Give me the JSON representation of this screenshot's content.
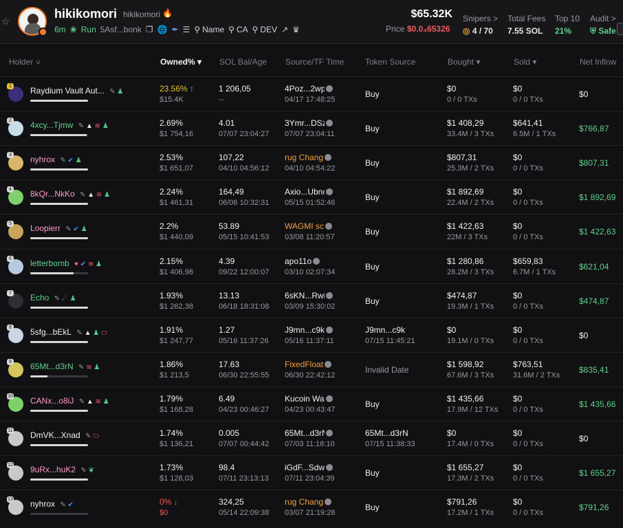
{
  "header": {
    "token_name": "hikikomori",
    "token_symbol": "hikikomori",
    "age": "6m",
    "run_label": "Run",
    "contract_short": "5Asf...bonk",
    "search_links": [
      "Name",
      "CA",
      "DEV"
    ],
    "market_cap": "$65.32K",
    "price_label": "Price",
    "price_value": "$0.0₄65326",
    "stats": [
      {
        "label": "Snipers >",
        "value": "4 / 70"
      },
      {
        "label": "Total Fees",
        "value": "7.55 SOL"
      },
      {
        "label": "Top 10",
        "value": "21%"
      },
      {
        "label": "Audit >",
        "value": "Safe"
      }
    ]
  },
  "columns": {
    "holder": "Holder",
    "owned": "Owned%",
    "sol_bal": "SOL Bal/Age",
    "source": "Source/TF Time",
    "token_source": "Token Source",
    "bought": "Bought",
    "sold": "Sold",
    "net_inflow": "Net Inflow"
  },
  "holders": [
    {
      "rank": "1",
      "name": "Raydium Vault Aut...",
      "owned": "23.56%",
      "owned_usd": "$15.4K",
      "sol": "1 206,05",
      "age": "--",
      "source": "4Poz...2wp",
      "source_time": "04/17 17:48:25",
      "token_source": "Buy",
      "token_source_time": "",
      "bought": "$0",
      "bought_txs": "0 / 0 TXs",
      "sold": "$0",
      "sold_txs": "0 / 0 TXs",
      "net": "$0",
      "bar_fill": 1.0
    },
    {
      "rank": "2",
      "name": "4xcy...Tjmw",
      "owned": "2.69%",
      "owned_usd": "$1 754,16",
      "sol": "4.01",
      "age": "07/07 23:04:27",
      "source": "3Ymr...DSz",
      "source_time": "07/07 23:04:11",
      "token_source": "Buy",
      "token_source_time": "",
      "bought": "$1 408,29",
      "bought_txs": "33.4M / 3 TXs",
      "sold": "$641,41",
      "sold_txs": "6.5M / 1 TXs",
      "net": "$766,87",
      "bar_fill": 0.98
    },
    {
      "rank": "3",
      "name": "nyhrox",
      "owned": "2.53%",
      "owned_usd": "$1 651,07",
      "sol": "107,22",
      "age": "04/10 04:56:12",
      "source": "rug Chang",
      "source_time": "04/10 04:54:22",
      "token_source": "Buy",
      "token_source_time": "",
      "bought": "$807,31",
      "bought_txs": "25.3M / 2 TXs",
      "sold": "$0",
      "sold_txs": "0 / 0 TXs",
      "net": "$807,31",
      "bar_fill": 1.0
    },
    {
      "rank": "4",
      "name": "8kQr...NkKo",
      "owned": "2.24%",
      "owned_usd": "$1 461,31",
      "sol": "164,49",
      "age": "06/06 10:32:31",
      "source": "Axio...Ubnc",
      "source_time": "05/15 01:52:46",
      "token_source": "Buy",
      "token_source_time": "",
      "bought": "$1 892,69",
      "bought_txs": "22.4M / 2 TXs",
      "sold": "$0",
      "sold_txs": "0 / 0 TXs",
      "net": "$1 892,69",
      "bar_fill": 1.0
    },
    {
      "rank": "5",
      "name": "Loopierr",
      "owned": "2.2%",
      "owned_usd": "$1 440,09",
      "sol": "53.89",
      "age": "05/15 10:41:53",
      "source": "WAGMI sc",
      "source_time": "03/08 11:20:57",
      "token_source": "Buy",
      "token_source_time": "",
      "bought": "$1 422,63",
      "bought_txs": "22M / 3 TXs",
      "sold": "$0",
      "sold_txs": "0 / 0 TXs",
      "net": "$1 422,63",
      "bar_fill": 1.0
    },
    {
      "rank": "6",
      "name": "letterbomb",
      "owned": "2.15%",
      "owned_usd": "$1 406,98",
      "sol": "4.39",
      "age": "09/22 12:00:07",
      "source": "apo11o",
      "source_time": "03/10 02:07:34",
      "token_source": "Buy",
      "token_source_time": "",
      "bought": "$1 280,86",
      "bought_txs": "28.2M / 3 TXs",
      "sold": "$659,83",
      "sold_txs": "6.7M / 1 TXs",
      "net": "$621,04",
      "bar_fill": 0.75
    },
    {
      "rank": "7",
      "name": "Echo",
      "owned": "1.93%",
      "owned_usd": "$1 262,38",
      "sol": "13.13",
      "age": "06/18 18:31:08",
      "source": "6sKN...Rwi",
      "source_time": "03/09 15:30:02",
      "token_source": "Buy",
      "token_source_time": "",
      "bought": "$474,87",
      "bought_txs": "19.3M / 1 TXs",
      "sold": "$0",
      "sold_txs": "0 / 0 TXs",
      "net": "$474,87",
      "bar_fill": 1.0
    },
    {
      "rank": "8",
      "name": "5sfg...bEkL",
      "owned": "1.91%",
      "owned_usd": "$1 247,77",
      "sol": "1.27",
      "age": "05/16 11:37:26",
      "source": "J9mn...c9k",
      "source_time": "05/16 11:37:11",
      "token_source": "J9mn...c9k",
      "token_source_time": "07/15 11:45:21",
      "bought": "$0",
      "bought_txs": "19.1M / 0 TXs",
      "sold": "$0",
      "sold_txs": "0 / 0 TXs",
      "net": "$0",
      "bar_fill": 1.0
    },
    {
      "rank": "9",
      "name": "65Mt...d3rN",
      "owned": "1.86%",
      "owned_usd": "$1 213,5",
      "sol": "17.63",
      "age": "06/30 22:55:55",
      "source": "FixedFloat",
      "source_time": "06/30 22:42:12",
      "token_source": "Invalid Date",
      "token_source_time": "",
      "bought": "$1 598,92",
      "bought_txs": "67.6M / 3 TXs",
      "sold": "$763,51",
      "sold_txs": "31.6M / 2 TXs",
      "net": "$835,41",
      "bar_fill": 0.3
    },
    {
      "rank": "10",
      "name": "CANx...o8iJ",
      "owned": "1.79%",
      "owned_usd": "$1 168,28",
      "sol": "6.49",
      "age": "04/23 00:46:27",
      "source": "Kucoin Wa",
      "source_time": "04/23 00:43:47",
      "token_source": "Buy",
      "token_source_time": "",
      "bought": "$1 435,66",
      "bought_txs": "17.9M / 12 TXs",
      "sold": "$0",
      "sold_txs": "0 / 0 TXs",
      "net": "$1 435,66",
      "bar_fill": 1.0
    },
    {
      "rank": "11",
      "name": "DmVK...Xnad",
      "owned": "1.74%",
      "owned_usd": "$1 136,21",
      "sol": "0.005",
      "age": "07/07 00:44:42",
      "source": "65Mt...d3rN",
      "source_time": "07/03 11:18:10",
      "token_source": "65Mt...d3rN",
      "token_source_time": "07/15 11:38:33",
      "bought": "$0",
      "bought_txs": "17.4M / 0 TXs",
      "sold": "$0",
      "sold_txs": "0 / 0 TXs",
      "net": "$0",
      "bar_fill": 1.0
    },
    {
      "rank": "12",
      "name": "9uRx...huK2",
      "owned": "1.73%",
      "owned_usd": "$1 128,03",
      "sol": "98.4",
      "age": "07/11 23:13:13",
      "source": "iGdF...Sdw",
      "source_time": "07/11 23:04:39",
      "token_source": "Buy",
      "token_source_time": "",
      "bought": "$1 655,27",
      "bought_txs": "17.3M / 2 TXs",
      "sold": "$0",
      "sold_txs": "0 / 0 TXs",
      "net": "$1 655,27",
      "bar_fill": 1.0
    },
    {
      "rank": "13",
      "name": "nyhrox",
      "owned": "0%",
      "owned_usd": "$0",
      "sol": "324,25",
      "age": "05/14 22:09:38",
      "source": "rug Chang",
      "source_time": "03/07 21:19:28",
      "token_source": "Buy",
      "token_source_time": "",
      "bought": "$791,26",
      "bought_txs": "17.2M / 1 TXs",
      "sold": "$0",
      "sold_txs": "0 / 0 TXs",
      "net": "$791,26",
      "bar_fill": 0.0
    }
  ],
  "colors": {
    "accent_green": "#5fd38d",
    "accent_red": "#ef5a5a",
    "accent_orange": "#f0a040",
    "holder_pink": "#ff9bc4",
    "holder_green": "#5fd38d"
  }
}
